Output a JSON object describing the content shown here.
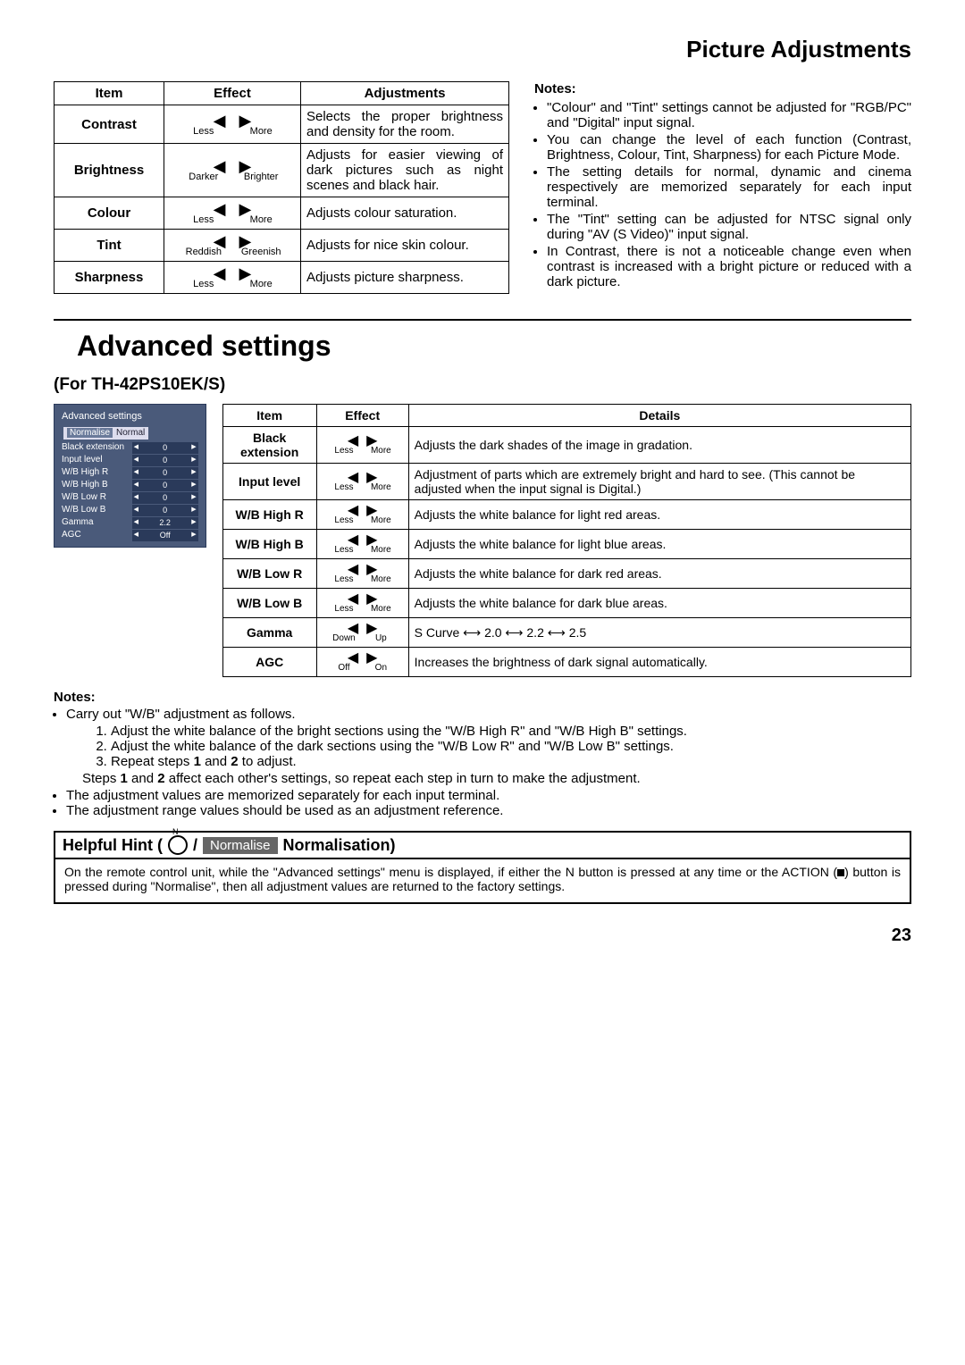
{
  "page_title": "Picture Adjustments",
  "page_number": "23",
  "picture_table": {
    "headers": {
      "item": "Item",
      "effect": "Effect",
      "adj": "Adjustments"
    },
    "rows": [
      {
        "item": "Contrast",
        "labL": "Less",
        "labR": "More",
        "adj": "Selects the proper brightness and density for the room."
      },
      {
        "item": "Brightness",
        "labL": "Darker",
        "labR": "Brighter",
        "adj": "Adjusts for easier viewing of dark pictures such as night scenes and black hair."
      },
      {
        "item": "Colour",
        "labL": "Less",
        "labR": "More",
        "adj": "Adjusts colour saturation."
      },
      {
        "item": "Tint",
        "labL": "Reddish",
        "labR": "Greenish",
        "adj": "Adjusts for nice skin colour."
      },
      {
        "item": "Sharpness",
        "labL": "Less",
        "labR": "More",
        "adj": "Adjusts picture sharpness."
      }
    ]
  },
  "notes_top": {
    "title": "Notes:",
    "items": [
      "\"Colour\" and \"Tint\" settings cannot be adjusted for \"RGB/PC\" and \"Digital\" input signal.",
      "You can change the level of each function (Contrast, Brightness, Colour, Tint, Sharpness) for each Picture Mode.",
      "The setting details for normal, dynamic and cinema respectively are memorized separately for each input terminal.",
      "The \"Tint\" setting can be adjusted for NTSC signal only during \"AV (S Video)\" input signal.",
      "In Contrast, there is not a noticeable change even when contrast is increased with a bright picture or reduced with a dark picture."
    ]
  },
  "advanced": {
    "heading": "Advanced settings",
    "model": "(For TH-42PS10EK/S)",
    "menu": {
      "title": "Advanced settings",
      "normalise_btn": "Normalise",
      "normal_label": "Normal",
      "items": [
        {
          "label": "Black extension",
          "val": "0"
        },
        {
          "label": "Input level",
          "val": "0"
        },
        {
          "label": "W/B High R",
          "val": "0"
        },
        {
          "label": "W/B High B",
          "val": "0"
        },
        {
          "label": "W/B Low R",
          "val": "0"
        },
        {
          "label": "W/B Low B",
          "val": "0"
        },
        {
          "label": "Gamma",
          "val": "2.2"
        },
        {
          "label": "AGC",
          "val": "Off"
        }
      ]
    },
    "table": {
      "headers": {
        "item": "Item",
        "effect": "Effect",
        "det": "Details"
      },
      "rows": [
        {
          "item": "Black extension",
          "labL": "Less",
          "labR": "More",
          "det": "Adjusts the dark shades of the image in gradation."
        },
        {
          "item": "Input level",
          "labL": "Less",
          "labR": "More",
          "det": "Adjustment of parts which are extremely bright and hard to see. (This cannot be adjusted when the input signal is Digital.)"
        },
        {
          "item": "W/B High R",
          "labL": "Less",
          "labR": "More",
          "det": "Adjusts the white balance for light red areas."
        },
        {
          "item": "W/B High B",
          "labL": "Less",
          "labR": "More",
          "det": "Adjusts the white balance for light blue areas."
        },
        {
          "item": "W/B Low R",
          "labL": "Less",
          "labR": "More",
          "det": "Adjusts the white balance for dark red areas."
        },
        {
          "item": "W/B Low B",
          "labL": "Less",
          "labR": "More",
          "det": "Adjusts the white balance for dark blue areas."
        },
        {
          "item": "Gamma",
          "labL": "Down",
          "labR": "Up",
          "det": "S Curve ⟷ 2.0 ⟷ 2.2 ⟷ 2.5"
        },
        {
          "item": "AGC",
          "labL": "Off",
          "labR": "On",
          "det": "Increases the brightness of dark signal automatically."
        }
      ]
    }
  },
  "notes_bottom": {
    "title": "Notes:",
    "bullet1": "Carry out \"W/B\" adjustment as follows.",
    "step1": "Adjust the white balance of the bright sections using the \"W/B High R\" and \"W/B High B\" settings.",
    "step2": "Adjust the white balance of the dark sections using the \"W/B Low R\" and \"W/B Low B\" settings.",
    "step3_a": "Repeat steps ",
    "step3_b": " and ",
    "step3_c": " to adjust.",
    "steps_aff_a": "Steps ",
    "steps_aff_b": " and ",
    "steps_aff_c": " affect each other's settings, so repeat each step in turn to make the adjustment.",
    "bullet2": "The adjustment values are memorized separately for each input terminal.",
    "bullet3": "The adjustment range values should be used as an adjustment reference.",
    "numlbl": {
      "n1": "1",
      "n2": "2",
      "n1b": "1.",
      "n2b": "2.",
      "n3b": "3."
    }
  },
  "hint": {
    "lead": "Helpful Hint (",
    "slash": " / ",
    "normpill": "Normalise",
    "tail": " Normalisation)",
    "circ_n": "N",
    "body_a": "On the remote control unit, while the \"Advanced settings\" menu is displayed, if either the N button is pressed at any time or the ACTION (",
    "body_b": ") button is pressed during \"Normalise\", then all adjustment values are returned to the factory settings."
  }
}
